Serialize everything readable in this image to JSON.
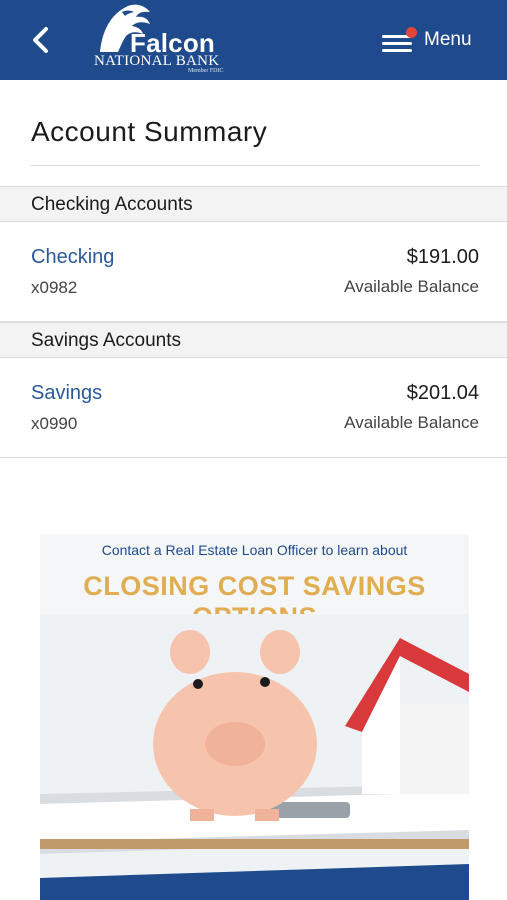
{
  "header": {
    "brand_name": "Falcon",
    "brand_sub": "NATIONAL BANK",
    "brand_member": "Member FDIC",
    "menu_label": "Menu",
    "back_icon": "chevron-left-icon",
    "menu_icon": "hamburger-icon",
    "notification_color": "#e0463a",
    "bar_color": "#1f4a8c"
  },
  "page": {
    "title": "Account Summary"
  },
  "sections": [
    {
      "label": "Checking Accounts",
      "account": {
        "name": "Checking",
        "number": "x0982",
        "balance": "$191.00",
        "balance_label": "Available Balance"
      }
    },
    {
      "label": "Savings Accounts",
      "account": {
        "name": "Savings",
        "number": "x0990",
        "balance": "$201.04",
        "balance_label": "Available Balance"
      }
    }
  ],
  "ad": {
    "top_text": "Contact a Real Estate Loan Officer to learn about",
    "headline": "CLOSING COST SAVINGS OPTIONS",
    "accent_color": "#e0ad52"
  },
  "colors": {
    "link": "#2a5a9b"
  }
}
